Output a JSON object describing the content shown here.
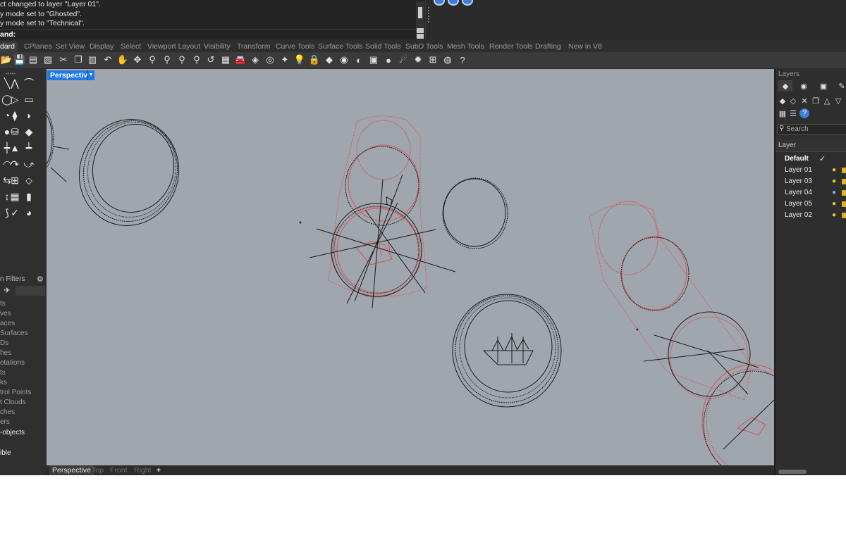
{
  "command": {
    "history": [
      "ct changed to layer \"Layer 01\".",
      "y mode set to \"Ghosted\".",
      "y mode set to \"Technical\"."
    ],
    "prompt": "and:"
  },
  "toolbar_tabs": [
    "dard",
    "CPlanes",
    "Set View",
    "Display",
    "Select",
    "Viewport Layout",
    "Visibility",
    "Transform",
    "Curve Tools",
    "Surface Tools",
    "Solid Tools",
    "SubD Tools",
    "Mesh Tools",
    "Render Tools",
    "Drafting",
    "New in V8"
  ],
  "toolbar_icons": [
    "open-file-icon",
    "save-icon",
    "print-icon",
    "import-icon",
    "cut-icon",
    "copy-icon",
    "paste-icon",
    "undo-icon",
    "pan-icon",
    "rotate-view-icon",
    "zoom-icon",
    "zoom-window-icon",
    "zoom-extents-icon",
    "zoom-selected-icon",
    "undo-view-icon",
    "four-viewports-icon",
    "options-icon",
    "object-properties-icon",
    "named-views-icon",
    "light-icon",
    "lock-icon",
    "layers-icon",
    "color-wheel-icon",
    "shaded-icon",
    "rendered-icon",
    "display-mode-icon",
    "sun-icon",
    "gumball-icon",
    "material-icon",
    "help-icon"
  ],
  "viewport": {
    "title": "Perspective",
    "tabs": [
      "Perspective",
      "Top",
      "Front",
      "Right"
    ],
    "add_tab": "+"
  },
  "selection_filters": {
    "header": "n Filters",
    "items": [
      {
        "label": "ts",
        "on": false
      },
      {
        "label": "ves",
        "on": false
      },
      {
        "label": "aces",
        "on": false
      },
      {
        "label": "Surfaces",
        "on": false
      },
      {
        "label": "Ds",
        "on": false
      },
      {
        "label": "hes",
        "on": false
      },
      {
        "label": "otations",
        "on": false
      },
      {
        "label": "ts",
        "on": false
      },
      {
        "label": "ks",
        "on": false
      },
      {
        "label": "trol Points",
        "on": false
      },
      {
        "label": "t Clouds",
        "on": false
      },
      {
        "label": "ches",
        "on": false
      },
      {
        "label": "ers",
        "on": false
      },
      {
        "label": "-objects",
        "on": true
      },
      {
        "label": "",
        "on": false
      },
      {
        "label": "ible",
        "on": true
      }
    ]
  },
  "layers_panel": {
    "title": "Layers",
    "search_placeholder": "Search",
    "column_header": "Layer",
    "rows": [
      {
        "name": "Default",
        "current": true,
        "bulb_color": "#ffffff"
      },
      {
        "name": "Layer 01",
        "current": false,
        "bulb_color": "#f2c82a"
      },
      {
        "name": "Layer 03",
        "current": false,
        "bulb_color": "#f2c82a"
      },
      {
        "name": "Layer 04",
        "current": false,
        "bulb_color": "#8aa7ff"
      },
      {
        "name": "Layer 05",
        "current": false,
        "bulb_color": "#f2c82a"
      },
      {
        "name": "Layer 02",
        "current": false,
        "bulb_color": "#f2c82a"
      }
    ]
  },
  "colors": {
    "viewport_bg": "#a0a6ae",
    "active_tab": "#1e79e6",
    "ghost_red": "#e04545",
    "wire_black": "#1a1a1a"
  }
}
